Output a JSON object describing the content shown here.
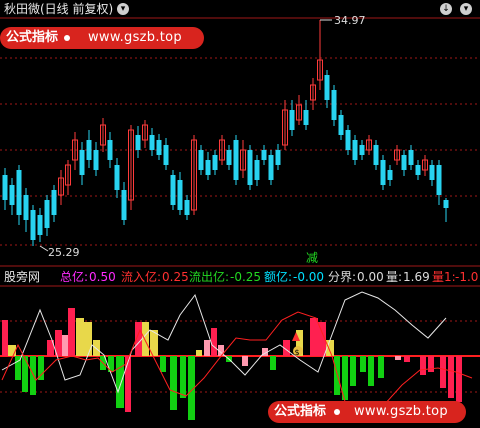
{
  "header": {
    "title": "秋田微(日线 前复权)",
    "toggle_icon": "chevron-down-icon",
    "corner_icons": [
      "down-icon",
      "chevron-down-icon"
    ]
  },
  "watermark": {
    "label": "公式指标",
    "url": "www.gszb.top"
  },
  "price_panel": {
    "high_label": "34.97",
    "low_label": "25.29",
    "signal_text": "减"
  },
  "indicator_panel": {
    "name": "股旁网",
    "items": [
      {
        "label": "总亿:",
        "value": "0.50",
        "color": "#ff2bff"
      },
      {
        "label": "流入亿:",
        "value": "0.25",
        "color": "#ff3030"
      },
      {
        "label": "流出亿:",
        "value": "-0.25",
        "color": "#22d822"
      },
      {
        "label": "额亿:",
        "value": "-0.00",
        "color": "#00e0ff"
      },
      {
        "label": "分界:",
        "value": "0.00",
        "color": "#dddddd"
      },
      {
        "label": "量:",
        "value": "1.69",
        "color": "#dddddd"
      },
      {
        "label": "量1:",
        "value": "-1.0",
        "color": "#ff3030"
      }
    ]
  },
  "colors": {
    "up": "#ff3b3b",
    "down": "#28d3f0",
    "grid": "#a01818",
    "bar_red": "#ff2050",
    "bar_green": "#12d012",
    "bar_yellow": "#e8d84a",
    "bar_pink": "#ff9ab0"
  }
}
